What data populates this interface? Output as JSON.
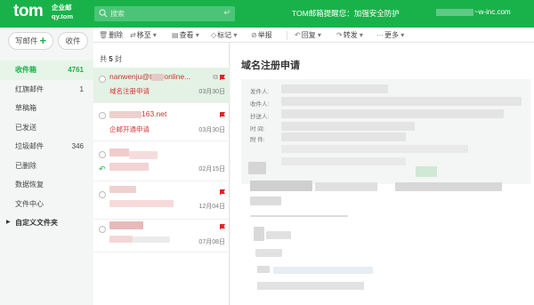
{
  "header": {
    "logo": "tom",
    "logo_sub_line1": "企业邮",
    "logo_sub_line2": "qy.tom",
    "search_placeholder": "搜索",
    "notice": "TOM邮箱提醒您：加强安全防护",
    "account_suffix": "~w-inc.com",
    "colors": {
      "bar": "#19b24a",
      "search_bg": "#4cc477"
    }
  },
  "sidebar": {
    "write_label": "写邮件",
    "receive_label": "收件",
    "items": [
      {
        "label": "收件箱",
        "count": "4761",
        "active": true
      },
      {
        "label": "红旗邮件",
        "count": "1"
      },
      {
        "label": "草稿箱",
        "count": ""
      },
      {
        "label": "已发送",
        "count": ""
      },
      {
        "label": "垃圾邮件",
        "count": "346"
      },
      {
        "label": "已删除",
        "count": ""
      },
      {
        "label": "数据恢复",
        "count": ""
      },
      {
        "label": "文件中心",
        "count": ""
      }
    ],
    "custom_folder_label": "自定义文件夹"
  },
  "toolbar": {
    "delete": "删除",
    "move": "移至",
    "view": "查看",
    "mark": "标记",
    "report": "举报",
    "reply": "回复",
    "forward": "转发",
    "more": "更多"
  },
  "maillist": {
    "count_prefix": "共",
    "count_value": "5",
    "count_suffix": "封",
    "rows": [
      {
        "sender": "nanwenju@t",
        "sender_tail": "online...",
        "subject": "域名注册申请",
        "date": "03月30日",
        "selected": true
      },
      {
        "sender": "163.net",
        "subject": "企邮开通申请",
        "date": "03月30日"
      },
      {
        "sender": "",
        "subject": "",
        "date": "02月15日",
        "replied": true
      },
      {
        "sender": "",
        "subject": "",
        "date": "12月04日"
      },
      {
        "sender": "",
        "subject": "",
        "date": "07月08日"
      }
    ]
  },
  "reader": {
    "title": "域名注册申请",
    "meta_labels": [
      "发件人:",
      "收件人:",
      "抄送人:",
      "时 间:",
      "附 件:"
    ]
  }
}
